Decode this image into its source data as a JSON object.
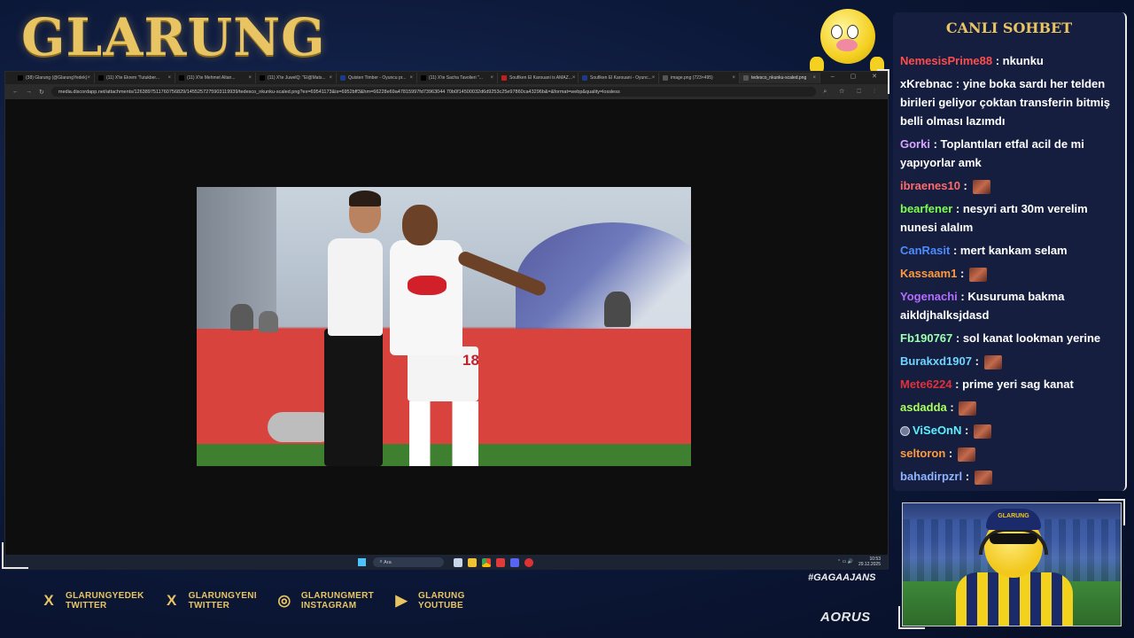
{
  "overlay": {
    "logo_text": "GLARUNG",
    "hashtag": "#GAGAAJANS",
    "sponsor": "AORUS",
    "socials": [
      {
        "icon": "x-icon",
        "line1": "GLARUNGYEDEK",
        "line2": "TWITTER"
      },
      {
        "icon": "x-icon",
        "line1": "GLARUNGYENI",
        "line2": "TWITTER"
      },
      {
        "icon": "instagram-icon",
        "line1": "GLARUNGMERT",
        "line2": "INSTAGRAM"
      },
      {
        "icon": "youtube-icon",
        "line1": "GLARUNG",
        "line2": "YOUTUBE"
      }
    ],
    "webcam": {
      "cap_text": "GLARUNG"
    }
  },
  "browser": {
    "tabs": [
      {
        "label": "(38) Glarung (@GlarungYedek)",
        "color": "#000000"
      },
      {
        "label": "(11) X'te Ekrem 'Tutukber...",
        "color": "#000000"
      },
      {
        "label": "(11) X'te Mehmet Altan...",
        "color": "#000000"
      },
      {
        "label": "(11) X'te JuwelQ: \"El@Mats...",
        "color": "#000000"
      },
      {
        "label": "Quisten Timber - Oyuncu pr...",
        "color": "#1a3a8a"
      },
      {
        "label": "(11) X'te Sacha Tavolieri \"...",
        "color": "#000000"
      },
      {
        "label": "Soufiken El Karouani is AMAZ...",
        "color": "#c02020"
      },
      {
        "label": "Soufiken El Karouani - Oyunc...",
        "color": "#1a3a8a"
      },
      {
        "label": "image.png (723×495)",
        "color": "#555555"
      },
      {
        "label": "tedesco_nkunku-scaled.png",
        "color": "#555555",
        "active": true
      }
    ],
    "url": "media.discordapp.net/attachments/1263897511760756829/1455257275903119939/tedesco_nkunku-scaled.png?ex=69541173&is=6952bff3&hm=66228e69a47815997fd73963044 70b0f14500032d6d9253c25e97860ca43296b&=&format=webp&quality=lossless",
    "photo_jersey_number": "18",
    "taskbar": {
      "search_placeholder": "Ara",
      "time": "10:53",
      "date": "29.12.2025"
    }
  },
  "chat": {
    "title": "CANLI SOHBET",
    "messages": [
      {
        "user": "NemesisPrime88",
        "color": "#ff4d4d",
        "text": "nkunku",
        "emote": false
      },
      {
        "user": "xKrebnac",
        "color": "#ffffff",
        "text": "yine boka sardı her telden birileri geliyor çoktan transferin bitmiş belli olması lazımdı",
        "emote": false
      },
      {
        "user": "Gorki",
        "color": "#d9a6ff",
        "text": "Toplantıları etfal acil de mi yapıyorlar amk",
        "emote": false
      },
      {
        "user": "ibraenes10",
        "color": "#ff6b6b",
        "text": "",
        "emote": true
      },
      {
        "user": "bearfener",
        "color": "#7dff4d",
        "text": "nesyri artı 30m verelim nunesi alalım",
        "emote": false
      },
      {
        "user": "CanRasit",
        "color": "#4d8cff",
        "text": "mert kankam selam",
        "emote": false
      },
      {
        "user": "Kassaam1",
        "color": "#ff9a3c",
        "text": "",
        "emote": true
      },
      {
        "user": "Yogenachi",
        "color": "#b46cff",
        "text": "Kusuruma bakma aikldjhalksjdasd",
        "emote": false
      },
      {
        "user": "Fb190767",
        "color": "#9dffb0",
        "text": "sol kanat lookman yerine",
        "emote": false
      },
      {
        "user": "Burakxd1907",
        "color": "#6fd4ff",
        "text": "",
        "emote": true
      },
      {
        "user": "Mete6224",
        "color": "#e0303a",
        "text": "prime yeri sag kanat",
        "emote": false
      },
      {
        "user": "asdadda",
        "color": "#a9ff5c",
        "text": "",
        "emote": true
      },
      {
        "user": "ViSeOnN",
        "color": "#5cf0ff",
        "text": "",
        "emote": true,
        "badge": true
      },
      {
        "user": "seltoron",
        "color": "#ff9a3c",
        "text": "",
        "emote": true
      },
      {
        "user": "bahadirpzrl",
        "color": "#8fb4ff",
        "text": "",
        "emote": true
      }
    ]
  }
}
